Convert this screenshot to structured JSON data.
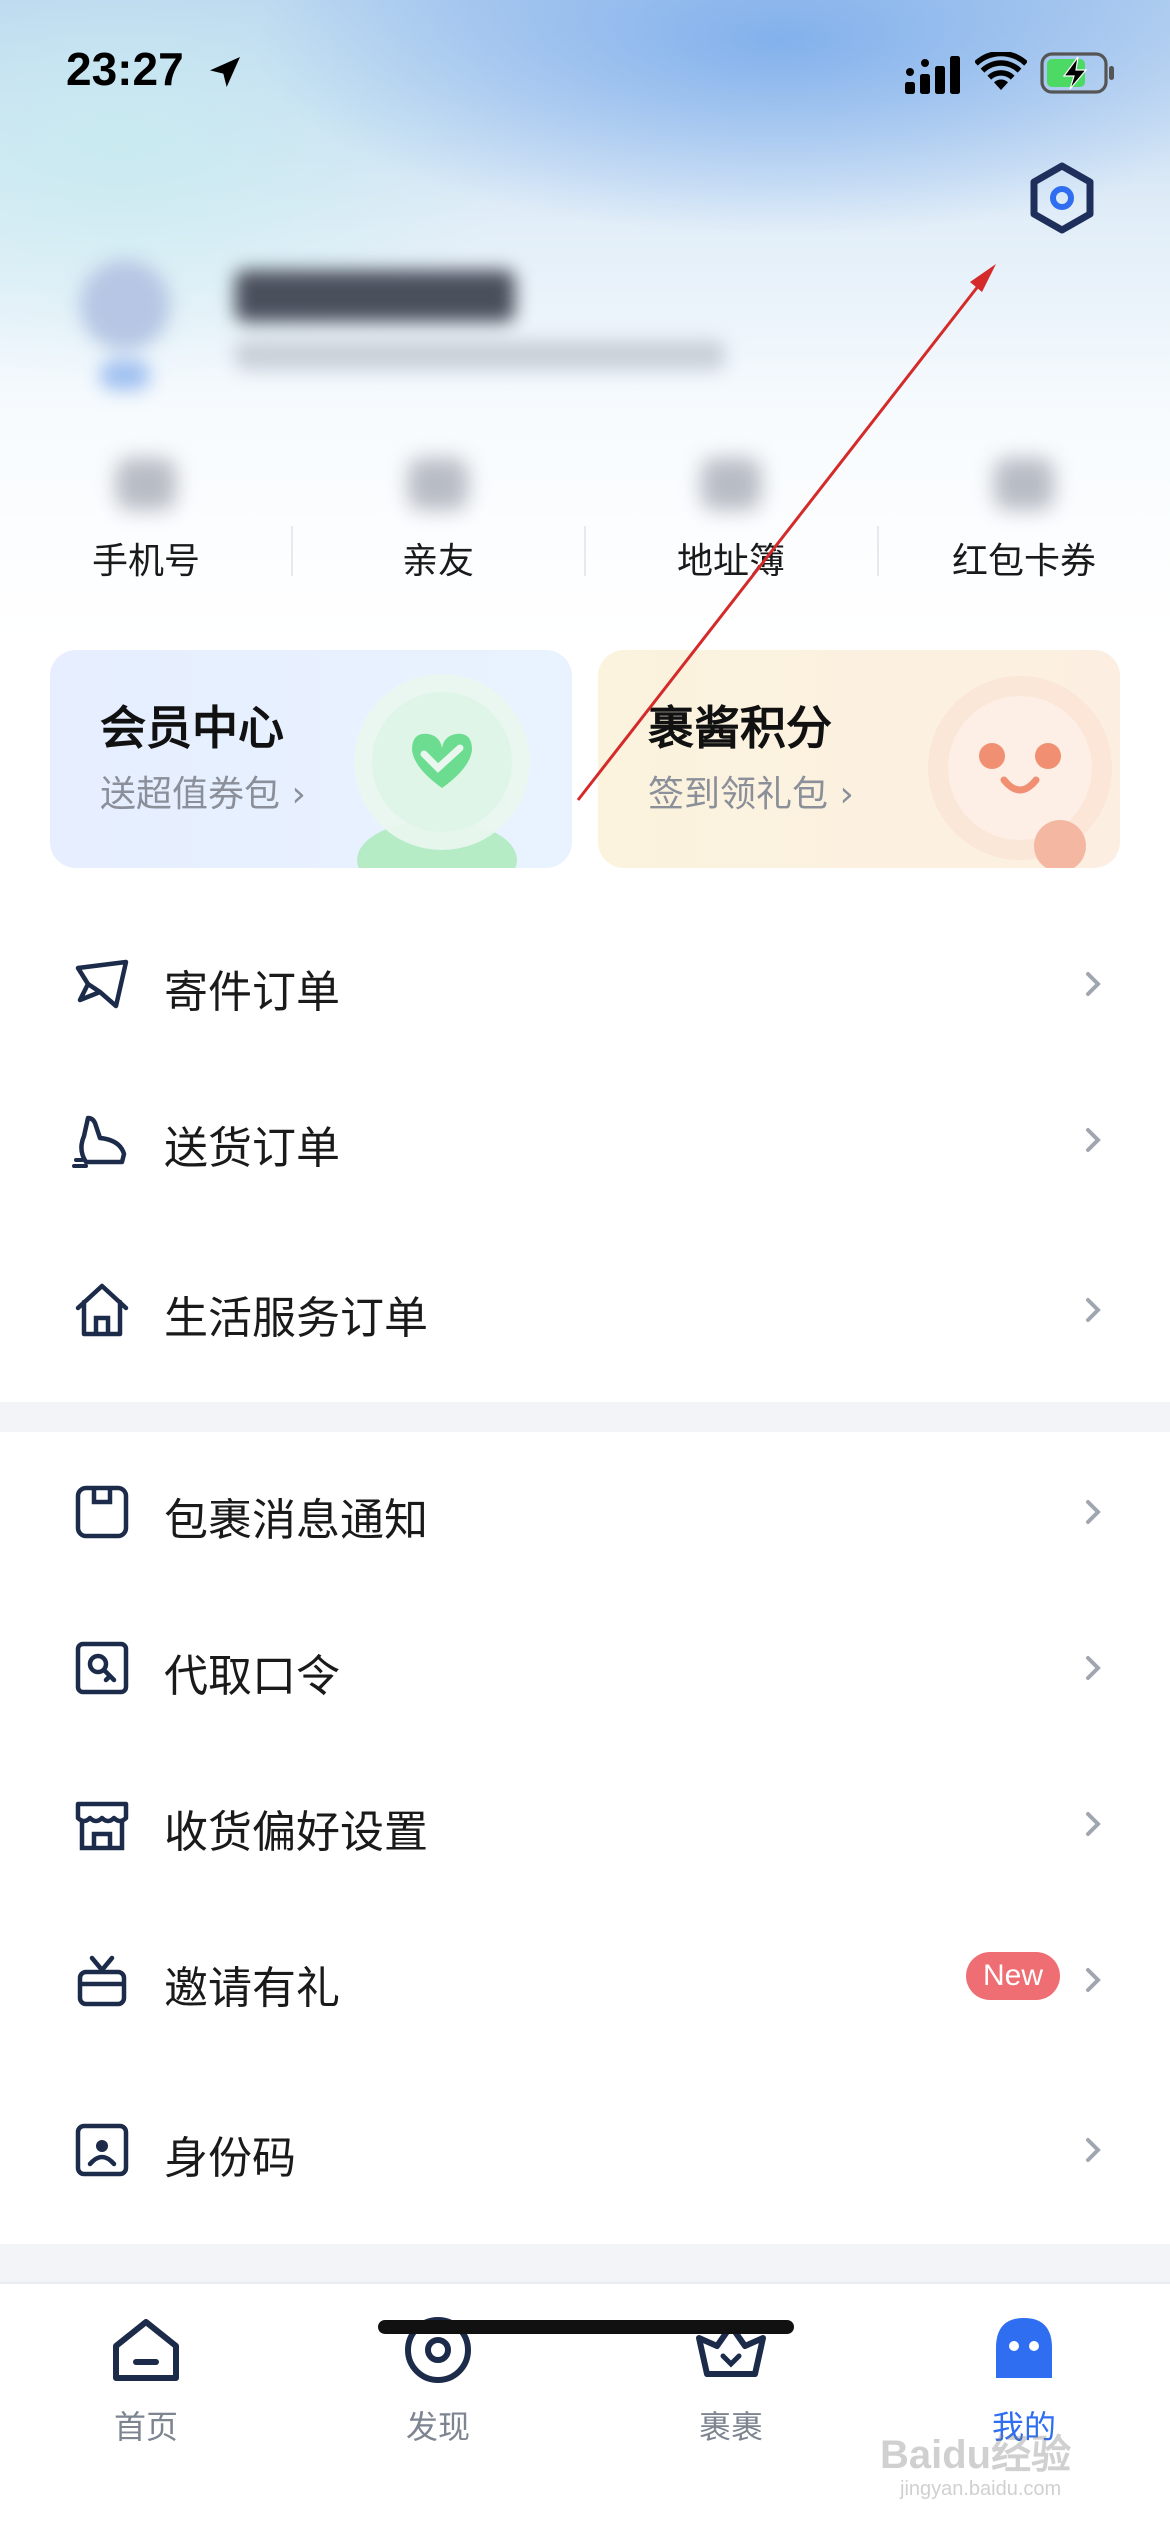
{
  "status_bar": {
    "time": "23:27"
  },
  "quick_links": [
    {
      "label": "手机号"
    },
    {
      "label": "亲友"
    },
    {
      "label": "地址簿"
    },
    {
      "label": "红包卡券"
    }
  ],
  "cards": {
    "member": {
      "title": "会员中心",
      "subtitle": "送超值券包"
    },
    "points": {
      "title": "裹酱积分",
      "subtitle": "签到领礼包"
    }
  },
  "menu_group_1": [
    {
      "label": "寄件订单",
      "icon": "send-plane-icon"
    },
    {
      "label": "送货订单",
      "icon": "delivery-boot-icon"
    },
    {
      "label": "生活服务订单",
      "icon": "home-icon"
    }
  ],
  "menu_group_2": [
    {
      "label": "包裹消息通知",
      "icon": "package-notice-icon"
    },
    {
      "label": "代取口令",
      "icon": "pickup-key-icon"
    },
    {
      "label": "收货偏好设置",
      "icon": "store-icon"
    },
    {
      "label": "邀请有礼",
      "icon": "gift-icon",
      "badge": "New"
    },
    {
      "label": "身份码",
      "icon": "id-code-icon"
    }
  ],
  "tabs": [
    {
      "label": "首页",
      "icon": "home-tab-icon"
    },
    {
      "label": "发现",
      "icon": "discover-tab-icon"
    },
    {
      "label": "裹裹",
      "icon": "guoguo-tab-icon"
    },
    {
      "label": "我的",
      "icon": "me-tab-icon",
      "active": true
    }
  ],
  "watermark": {
    "text": "Baidu经验",
    "sub": "jingyan.baidu.com"
  },
  "colors": {
    "accent": "#2f6ef0",
    "badge": "#ee6e74",
    "annotation_arrow": "#d42a2a",
    "settings": "#1e2f5c"
  }
}
